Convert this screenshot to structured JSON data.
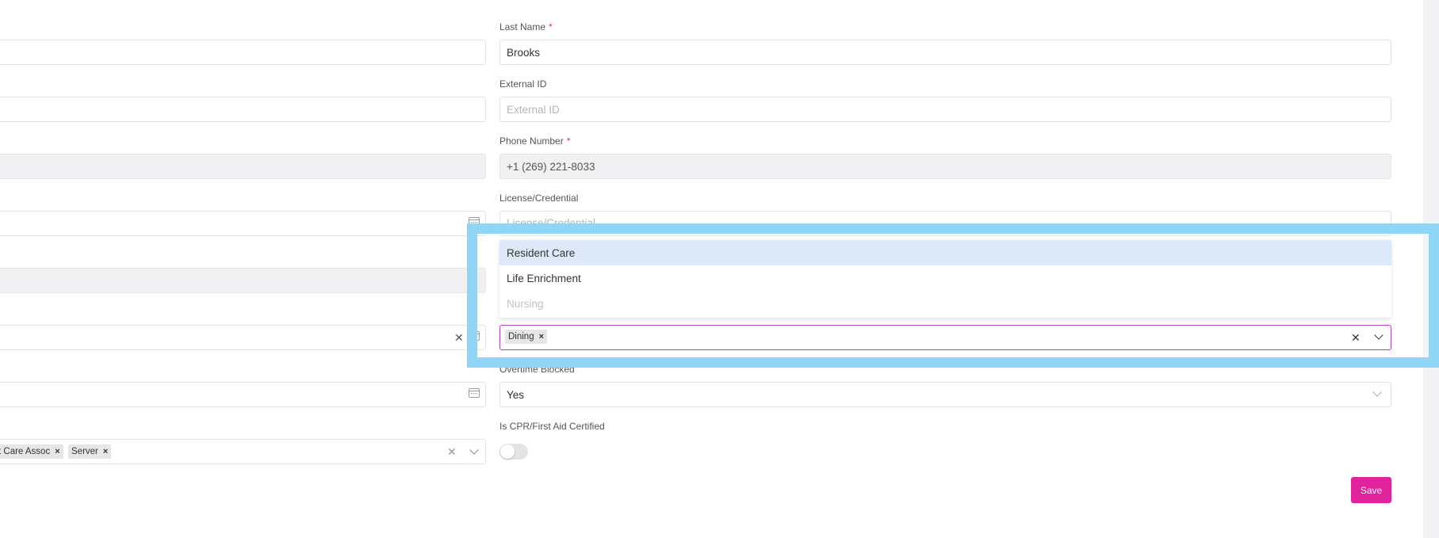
{
  "form": {
    "last_name": {
      "label": "Last Name",
      "required_mark": "*",
      "value": "Brooks"
    },
    "external_id": {
      "label": "External ID",
      "placeholder": "External ID"
    },
    "phone_number": {
      "label": "Phone Number",
      "required_mark": "*",
      "value": "+1 (269) 221-8033"
    },
    "license": {
      "label": "License/Credential",
      "placeholder": "License/Credential"
    },
    "departments": {
      "options": [
        {
          "label": "Resident Care",
          "state": "highlighted"
        },
        {
          "label": "Life Enrichment",
          "state": "normal"
        },
        {
          "label": "Nursing",
          "state": "disabled"
        }
      ],
      "selected_tags": [
        "Dining"
      ]
    },
    "overtime_blocked": {
      "label": "Overtime Blocked",
      "value": "Yes"
    },
    "cpr_certified": {
      "label": "Is CPR/First Aid Certified",
      "enabled": false
    },
    "positions": {
      "selected_tags": [
        "t Care Assoc",
        "Server"
      ]
    },
    "save_label": "Save"
  },
  "colors": {
    "accent": "#e0239a",
    "highlight_overlay": "#8fd6f6",
    "option_highlight": "#dde9f8",
    "focused_border": "#b13ec4"
  },
  "icons": [
    "calendar-icon",
    "clear-icon",
    "chevron-down-icon",
    "tag-remove-icon"
  ]
}
